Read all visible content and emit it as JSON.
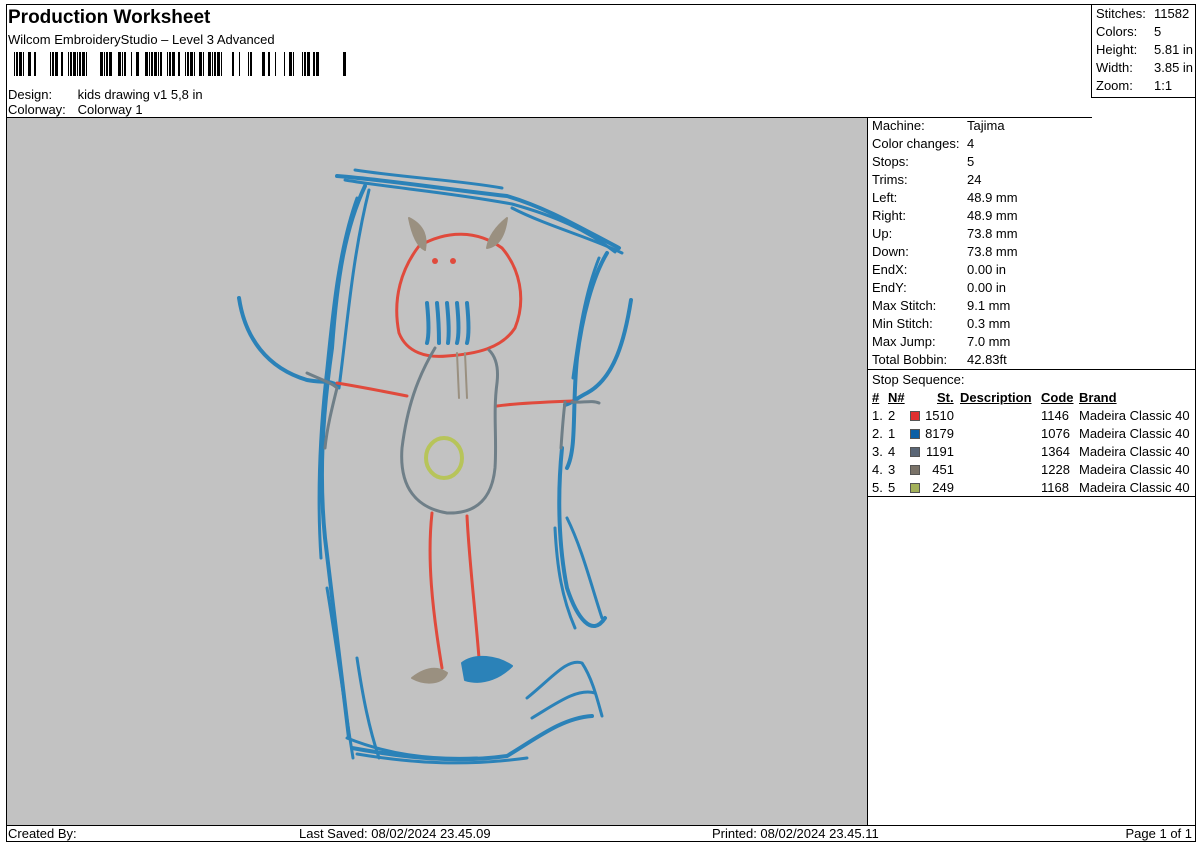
{
  "header": {
    "title": "Production Worksheet",
    "subtitle": "Wilcom EmbroideryStudio – Level 3 Advanced",
    "design_label": "Design:",
    "design_value": "kids drawing v1 5,8 in",
    "colorway_label": "Colorway:",
    "colorway_value": "Colorway 1"
  },
  "stats": [
    {
      "label": "Stitches:",
      "value": "11582"
    },
    {
      "label": "Colors:",
      "value": "5"
    },
    {
      "label": "Height:",
      "value": "5.81 in"
    },
    {
      "label": "Width:",
      "value": "3.85 in"
    },
    {
      "label": "Zoom:",
      "value": "1:1"
    }
  ],
  "machine": [
    {
      "label": "Machine:",
      "value": "Tajima"
    },
    {
      "label": "Color changes:",
      "value": "4"
    },
    {
      "label": "Stops:",
      "value": "5"
    },
    {
      "label": "Trims:",
      "value": "24"
    },
    {
      "label": "Left:",
      "value": "48.9 mm"
    },
    {
      "label": "Right:",
      "value": "48.9 mm"
    },
    {
      "label": "Up:",
      "value": "73.8 mm"
    },
    {
      "label": "Down:",
      "value": "73.8 mm"
    },
    {
      "label": "EndX:",
      "value": "0.00 in"
    },
    {
      "label": "EndY:",
      "value": "0.00 in"
    },
    {
      "label": "Max Stitch:",
      "value": "9.1 mm"
    },
    {
      "label": "Min Stitch:",
      "value": "0.3 mm"
    },
    {
      "label": "Max Jump:",
      "value": "7.0 mm"
    },
    {
      "label": "Total Bobbin:",
      "value": "42.83ft"
    }
  ],
  "stop_sequence": {
    "title": "Stop Sequence:",
    "columns": {
      "num": "#",
      "n": "N#",
      "st": "St.",
      "description": "Description",
      "code": "Code",
      "brand": "Brand"
    },
    "rows": [
      {
        "num": "1.",
        "n": "2",
        "color": "#e03030",
        "st": "1510",
        "description": "",
        "code": "1146",
        "brand": "Madeira Classic 40"
      },
      {
        "num": "2.",
        "n": "1",
        "color": "#0b5fa5",
        "st": "8179",
        "description": "",
        "code": "1076",
        "brand": "Madeira Classic 40"
      },
      {
        "num": "3.",
        "n": "4",
        "color": "#5a6676",
        "st": "1191",
        "description": "",
        "code": "1364",
        "brand": "Madeira Classic 40"
      },
      {
        "num": "4.",
        "n": "3",
        "color": "#7a7268",
        "st": "451",
        "description": "",
        "code": "1228",
        "brand": "Madeira Classic 40"
      },
      {
        "num": "5.",
        "n": "5",
        "color": "#a3b15a",
        "st": "249",
        "description": "",
        "code": "1168",
        "brand": "Madeira Classic 40"
      }
    ]
  },
  "footer": {
    "created_by": "Created By:",
    "last_saved": "Last Saved: 08/02/2024 23.45.09",
    "printed": "Printed: 08/02/2024 23.45.11",
    "page": "Page 1 of 1"
  },
  "colors": {
    "preview_bg": "#c2c2c2",
    "blue_thread": "#2b82b8",
    "red_thread": "#e04a3c",
    "gray_thread": "#6f7f88",
    "taupe_thread": "#9a9080",
    "green_thread": "#b7c45a"
  }
}
